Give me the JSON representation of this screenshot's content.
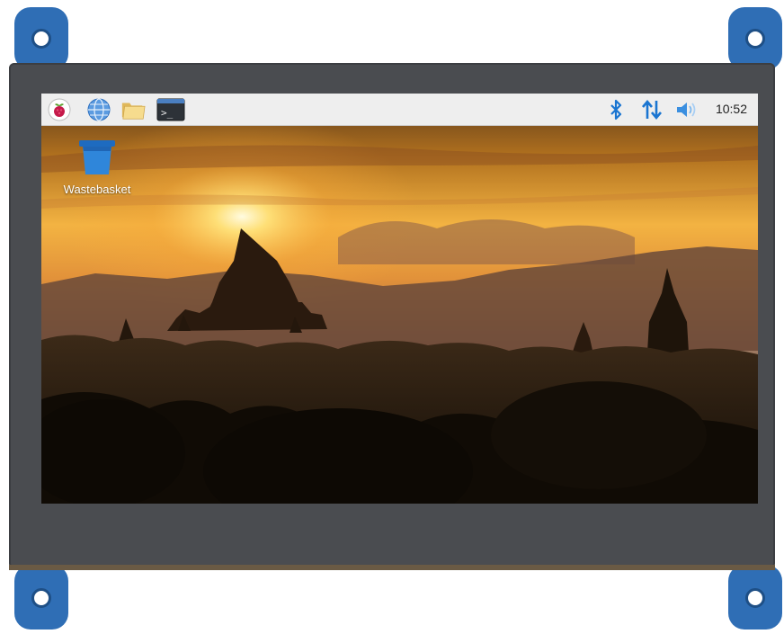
{
  "device": {
    "name": "HDMI touchscreen display",
    "bezel_color": "#4a4c50",
    "mount_tab_color": "#2f6eb5"
  },
  "taskbar": {
    "menu_icon": "raspberry-icon",
    "launchers": [
      {
        "name": "web-browser",
        "icon": "globe-icon"
      },
      {
        "name": "file-manager",
        "icon": "folder-icon"
      },
      {
        "name": "terminal",
        "icon": "terminal-icon",
        "glyph": ">_"
      }
    ],
    "tray": [
      {
        "name": "bluetooth",
        "icon": "bluetooth-icon"
      },
      {
        "name": "network",
        "icon": "network-arrows-icon"
      },
      {
        "name": "volume",
        "icon": "speaker-icon"
      }
    ],
    "clock": "10:52"
  },
  "desktop": {
    "icons": [
      {
        "label": "Wastebasket",
        "icon": "wastebasket-icon"
      }
    ],
    "wallpaper": "sunset over temple silhouettes"
  }
}
